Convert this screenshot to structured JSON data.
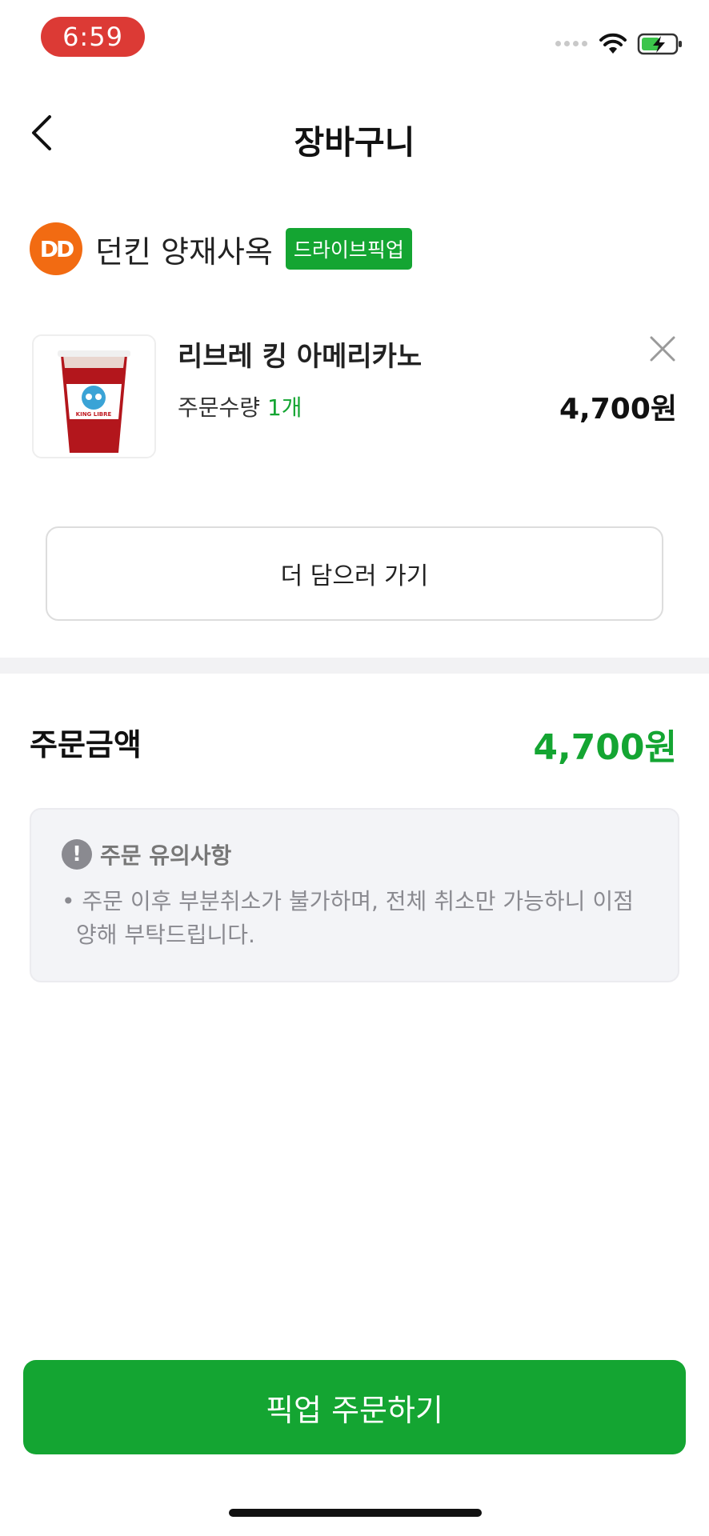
{
  "status_bar": {
    "time": "6:59"
  },
  "header": {
    "title": "장바구니"
  },
  "store": {
    "logo_text": "DD",
    "name": "던킨 양재사옥",
    "badge": "드라이브픽업"
  },
  "item": {
    "name": "리브레 킹 아메리카노",
    "qty_label": "주문수량",
    "qty_value": "1개",
    "price": "4,700원",
    "image_caption": "KING LIBRE"
  },
  "add_more_label": "더 담으러 가기",
  "order_total": {
    "label": "주문금액",
    "value": "4,700원"
  },
  "notice": {
    "title": "주문 유의사항",
    "icon": "!",
    "text": "• 주문 이후 부분취소가 불가하며, 전체 취소만 가능하니 이점 양해 부탁드립니다."
  },
  "cta_label": "픽업 주문하기",
  "colors": {
    "accent": "#14a532",
    "time_pill": "#dc3a35",
    "store_logo": "#f26b12"
  }
}
